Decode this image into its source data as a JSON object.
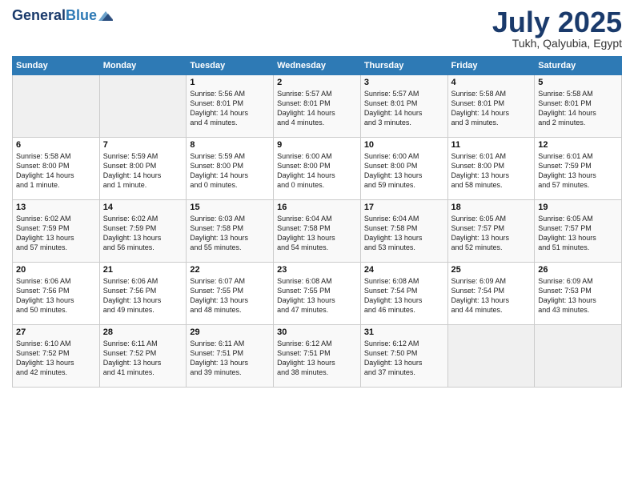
{
  "header": {
    "logo_line1": "General",
    "logo_line2": "Blue",
    "month": "July 2025",
    "location": "Tukh, Qalyubia, Egypt"
  },
  "weekdays": [
    "Sunday",
    "Monday",
    "Tuesday",
    "Wednesday",
    "Thursday",
    "Friday",
    "Saturday"
  ],
  "weeks": [
    [
      {
        "day": "",
        "info": ""
      },
      {
        "day": "",
        "info": ""
      },
      {
        "day": "1",
        "info": "Sunrise: 5:56 AM\nSunset: 8:01 PM\nDaylight: 14 hours\nand 4 minutes."
      },
      {
        "day": "2",
        "info": "Sunrise: 5:57 AM\nSunset: 8:01 PM\nDaylight: 14 hours\nand 4 minutes."
      },
      {
        "day": "3",
        "info": "Sunrise: 5:57 AM\nSunset: 8:01 PM\nDaylight: 14 hours\nand 3 minutes."
      },
      {
        "day": "4",
        "info": "Sunrise: 5:58 AM\nSunset: 8:01 PM\nDaylight: 14 hours\nand 3 minutes."
      },
      {
        "day": "5",
        "info": "Sunrise: 5:58 AM\nSunset: 8:01 PM\nDaylight: 14 hours\nand 2 minutes."
      }
    ],
    [
      {
        "day": "6",
        "info": "Sunrise: 5:58 AM\nSunset: 8:00 PM\nDaylight: 14 hours\nand 1 minute."
      },
      {
        "day": "7",
        "info": "Sunrise: 5:59 AM\nSunset: 8:00 PM\nDaylight: 14 hours\nand 1 minute."
      },
      {
        "day": "8",
        "info": "Sunrise: 5:59 AM\nSunset: 8:00 PM\nDaylight: 14 hours\nand 0 minutes."
      },
      {
        "day": "9",
        "info": "Sunrise: 6:00 AM\nSunset: 8:00 PM\nDaylight: 14 hours\nand 0 minutes."
      },
      {
        "day": "10",
        "info": "Sunrise: 6:00 AM\nSunset: 8:00 PM\nDaylight: 13 hours\nand 59 minutes."
      },
      {
        "day": "11",
        "info": "Sunrise: 6:01 AM\nSunset: 8:00 PM\nDaylight: 13 hours\nand 58 minutes."
      },
      {
        "day": "12",
        "info": "Sunrise: 6:01 AM\nSunset: 7:59 PM\nDaylight: 13 hours\nand 57 minutes."
      }
    ],
    [
      {
        "day": "13",
        "info": "Sunrise: 6:02 AM\nSunset: 7:59 PM\nDaylight: 13 hours\nand 57 minutes."
      },
      {
        "day": "14",
        "info": "Sunrise: 6:02 AM\nSunset: 7:59 PM\nDaylight: 13 hours\nand 56 minutes."
      },
      {
        "day": "15",
        "info": "Sunrise: 6:03 AM\nSunset: 7:58 PM\nDaylight: 13 hours\nand 55 minutes."
      },
      {
        "day": "16",
        "info": "Sunrise: 6:04 AM\nSunset: 7:58 PM\nDaylight: 13 hours\nand 54 minutes."
      },
      {
        "day": "17",
        "info": "Sunrise: 6:04 AM\nSunset: 7:58 PM\nDaylight: 13 hours\nand 53 minutes."
      },
      {
        "day": "18",
        "info": "Sunrise: 6:05 AM\nSunset: 7:57 PM\nDaylight: 13 hours\nand 52 minutes."
      },
      {
        "day": "19",
        "info": "Sunrise: 6:05 AM\nSunset: 7:57 PM\nDaylight: 13 hours\nand 51 minutes."
      }
    ],
    [
      {
        "day": "20",
        "info": "Sunrise: 6:06 AM\nSunset: 7:56 PM\nDaylight: 13 hours\nand 50 minutes."
      },
      {
        "day": "21",
        "info": "Sunrise: 6:06 AM\nSunset: 7:56 PM\nDaylight: 13 hours\nand 49 minutes."
      },
      {
        "day": "22",
        "info": "Sunrise: 6:07 AM\nSunset: 7:55 PM\nDaylight: 13 hours\nand 48 minutes."
      },
      {
        "day": "23",
        "info": "Sunrise: 6:08 AM\nSunset: 7:55 PM\nDaylight: 13 hours\nand 47 minutes."
      },
      {
        "day": "24",
        "info": "Sunrise: 6:08 AM\nSunset: 7:54 PM\nDaylight: 13 hours\nand 46 minutes."
      },
      {
        "day": "25",
        "info": "Sunrise: 6:09 AM\nSunset: 7:54 PM\nDaylight: 13 hours\nand 44 minutes."
      },
      {
        "day": "26",
        "info": "Sunrise: 6:09 AM\nSunset: 7:53 PM\nDaylight: 13 hours\nand 43 minutes."
      }
    ],
    [
      {
        "day": "27",
        "info": "Sunrise: 6:10 AM\nSunset: 7:52 PM\nDaylight: 13 hours\nand 42 minutes."
      },
      {
        "day": "28",
        "info": "Sunrise: 6:11 AM\nSunset: 7:52 PM\nDaylight: 13 hours\nand 41 minutes."
      },
      {
        "day": "29",
        "info": "Sunrise: 6:11 AM\nSunset: 7:51 PM\nDaylight: 13 hours\nand 39 minutes."
      },
      {
        "day": "30",
        "info": "Sunrise: 6:12 AM\nSunset: 7:51 PM\nDaylight: 13 hours\nand 38 minutes."
      },
      {
        "day": "31",
        "info": "Sunrise: 6:12 AM\nSunset: 7:50 PM\nDaylight: 13 hours\nand 37 minutes."
      },
      {
        "day": "",
        "info": ""
      },
      {
        "day": "",
        "info": ""
      }
    ]
  ]
}
